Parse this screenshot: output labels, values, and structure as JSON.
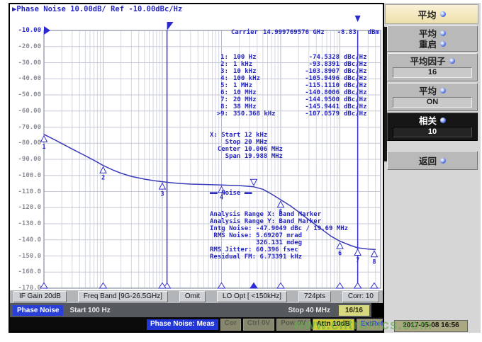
{
  "screen": {
    "title_icon": "▶",
    "title": "Phase Noise 10.00dB/ Ref -10.00dBc/Hz",
    "carrier": {
      "label": "Carrier",
      "freq": "14.999769576 GHz",
      "power": "-8.83",
      "unit": "dBm"
    },
    "marker_table": [
      {
        "n": "1:",
        "freq": "100 Hz",
        "value": "-74.5328",
        "unit": "dBc/Hz"
      },
      {
        "n": "2:",
        "freq": "1 kHz",
        "value": "-93.8391",
        "unit": "dBc/Hz"
      },
      {
        "n": "3:",
        "freq": "10 kHz",
        "value": "-103.8907",
        "unit": "dBc/Hz"
      },
      {
        "n": "4:",
        "freq": "100 kHz",
        "value": "-105.9496",
        "unit": "dBc/Hz"
      },
      {
        "n": "5:",
        "freq": "1 MHz",
        "value": "-115.1110",
        "unit": "dBc/Hz"
      },
      {
        "n": "6:",
        "freq": "10 MHz",
        "value": "-140.8006",
        "unit": "dBc/Hz"
      },
      {
        "n": "7:",
        "freq": "20 MHz",
        "value": "-144.9500",
        "unit": "dBc/Hz"
      },
      {
        "n": "8:",
        "freq": "38 MHz",
        "value": "-145.9441",
        "unit": "dBc/Hz"
      },
      {
        "n": ">9:",
        "freq": "350.368 kHz",
        "value": "-107.0579",
        "unit": "dBc/Hz"
      }
    ],
    "band_lines": [
      "X: Start 12 kHz",
      "    Stop 20 MHz",
      "  Center 10.006 MHz",
      "    Span 19.988 MHz"
    ],
    "noise_title": "▬▬ Noise ▬▬",
    "noise_lines": [
      "Analysis Range X: Band Marker",
      "Analysis Range Y: Band Marker",
      "Intg Noise: -47.9049 dBc / 19.69 MHz",
      " RMS Noise: 5.69207 mrad",
      "            326.131 mdeg",
      "RMS Jitter: 60.396 fsec",
      "Residual FM: 6.73391 kHz"
    ]
  },
  "chart_data": {
    "type": "line",
    "title": "Phase Noise 10.00dB/ Ref -10.00dBc/Hz",
    "x_axis": {
      "scale": "log",
      "start_hz": 100,
      "stop_hz": 40000000,
      "start_label": "100 Hz",
      "stop_label": "40 MHz"
    },
    "y_axis": {
      "unit": "dBc/Hz",
      "ref": -10,
      "bottom": -170,
      "step": 10,
      "tick_labels": [
        "-10.00",
        "-20.00",
        "-30.00",
        "-40.00",
        "-50.00",
        "-60.00",
        "-70.00",
        "-80.00",
        "-90.00",
        "-100.0",
        "-110.0",
        "-120.0",
        "-130.0",
        "-140.0",
        "-150.0",
        "-160.0",
        "-170.0"
      ]
    },
    "grid": true,
    "trace_color": "#3a3ab8",
    "series": [
      {
        "name": "phase-noise-trace",
        "points": [
          [
            100,
            -74.53
          ],
          [
            150,
            -77.8
          ],
          [
            200,
            -80.2
          ],
          [
            300,
            -83.6
          ],
          [
            500,
            -87.8
          ],
          [
            700,
            -90.6
          ],
          [
            1000,
            -93.84
          ],
          [
            1500,
            -96.8
          ],
          [
            2000,
            -98.6
          ],
          [
            3000,
            -100.6
          ],
          [
            5000,
            -102.3
          ],
          [
            7000,
            -103.2
          ],
          [
            10000,
            -103.89
          ],
          [
            15000,
            -104.6
          ],
          [
            20000,
            -105.0
          ],
          [
            30000,
            -105.4
          ],
          [
            50000,
            -105.6
          ],
          [
            70000,
            -105.8
          ],
          [
            100000,
            -105.95
          ],
          [
            150000,
            -106.2
          ],
          [
            200000,
            -106.3
          ],
          [
            300000,
            -106.8
          ],
          [
            350368,
            -107.06
          ],
          [
            500000,
            -108.6
          ],
          [
            700000,
            -111.6
          ],
          [
            1000000,
            -115.11
          ],
          [
            1500000,
            -119.2
          ],
          [
            2000000,
            -122.6
          ],
          [
            3000000,
            -127.6
          ],
          [
            5000000,
            -133.6
          ],
          [
            7000000,
            -137.6
          ],
          [
            10000000,
            -140.8
          ],
          [
            15000000,
            -143.4
          ],
          [
            20000000,
            -144.95
          ],
          [
            30000000,
            -145.7
          ],
          [
            38000000,
            -145.94
          ],
          [
            40000000,
            -146.0
          ]
        ]
      }
    ],
    "markers": [
      {
        "n": "1",
        "hz": 100,
        "db": -74.5328
      },
      {
        "n": "2",
        "hz": 1000,
        "db": -93.8391
      },
      {
        "n": "3",
        "hz": 10000,
        "db": -103.8907
      },
      {
        "n": "4",
        "hz": 100000,
        "db": -105.9496
      },
      {
        "n": "5",
        "hz": 1000000,
        "db": -115.111
      },
      {
        "n": "6",
        "hz": 10000000,
        "db": -140.8006
      },
      {
        "n": "7",
        "hz": 20000000,
        "db": -144.95
      },
      {
        "n": "8",
        "hz": 38000000,
        "db": -145.9441
      },
      {
        "n": "9",
        "hz": 350368,
        "db": -107.0579,
        "active": true
      }
    ],
    "band_markers_hz": [
      12000,
      20000000
    ]
  },
  "toolbar": {
    "items": [
      "IF Gain 20dB",
      "Freq Band [9G-26.5GHz]",
      "Omit",
      "LO Opt [ <150kHz]",
      "724pts",
      "Corr: 10"
    ]
  },
  "status_bar": {
    "mode": "Phase Noise",
    "start": "Start 100 Hz",
    "stop": "Stop 40 MHz",
    "pages": "16/16"
  },
  "bottom_bar": {
    "meas": "Phase Noise: Meas",
    "disabled": [
      "Cor",
      "Ctrl 0V",
      "Pow 0V"
    ],
    "attn": "Attn 10dB",
    "extref": "ExtRef",
    "datetime": "2017-05-08 16:56"
  },
  "watermark": "www.cntronics.com",
  "side_menu": {
    "header": "平均",
    "buttons": [
      {
        "lines": [
          "平均",
          "重启"
        ]
      },
      {
        "lines": [
          "平均因子"
        ],
        "value": "16"
      },
      {
        "lines": [
          "平均"
        ],
        "value": "ON"
      },
      {
        "lines": [
          "相关"
        ],
        "value": "10",
        "selected": true
      },
      {
        "lines": [
          "返回"
        ],
        "return": true
      }
    ]
  }
}
